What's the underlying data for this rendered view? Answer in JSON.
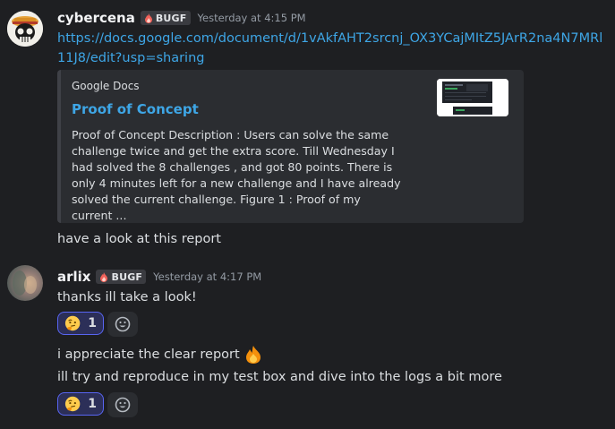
{
  "messages": [
    {
      "username": "cybercena",
      "tag": "BUGF",
      "timestamp": "Yesterday at 4:15 PM",
      "link": "https://docs.google.com/document/d/1vAkfAHT2srcnj_OX3YCajMItZ5JArR2na4N7MRl11J8/edit?usp=sharing",
      "embed": {
        "provider": "Google Docs",
        "title": "Proof of Concept",
        "description": "Proof of Concept Description : Users can solve the same challenge twice and get the extra score. Till Wednesday I had solved the 8 challenges , and got 80 points. There is only 4 minutes left for a new challenge and I have already solved the current challenge. Figure 1 : Proof of my current ..."
      },
      "followup_text": "have a look at this report"
    },
    {
      "username": "arlix",
      "tag": "BUGF",
      "timestamp": "Yesterday at 4:17 PM",
      "text1": "thanks ill take a look!",
      "reaction1_count": "1",
      "text2": "i appreciate the clear report",
      "text3": "ill try and reproduce in my test box and dive into the logs a bit more",
      "reaction2_count": "1"
    }
  ],
  "colors": {
    "background": "#1e1f22",
    "link": "#3ea6e6",
    "reaction_border": "#5865f2"
  },
  "icons": [
    "skull-avatar-icon",
    "blurred-avatar-icon",
    "fire-tag-icon",
    "thinking-face-icon",
    "fire-emoji-icon",
    "add-reaction-icon"
  ]
}
